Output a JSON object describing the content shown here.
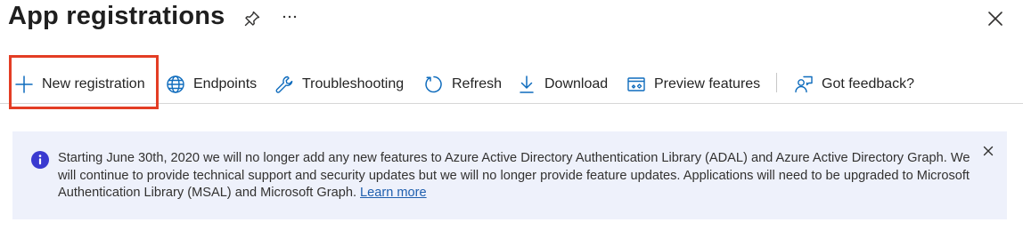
{
  "header": {
    "title": "App registrations"
  },
  "icons": {
    "pin": "pin-icon",
    "more": "more-icon",
    "close": "close-icon",
    "new_registration": "plus-icon",
    "endpoints": "globe-icon",
    "troubleshooting": "wrench-icon",
    "refresh": "refresh-icon",
    "download": "download-icon",
    "preview_features": "preview-icon",
    "feedback": "feedback-icon",
    "banner_info": "info-icon",
    "banner_close": "close-icon"
  },
  "toolbar": {
    "new_registration": "New registration",
    "endpoints": "Endpoints",
    "troubleshooting": "Troubleshooting",
    "refresh": "Refresh",
    "download": "Download",
    "preview_features": "Preview features",
    "got_feedback": "Got feedback?"
  },
  "banner": {
    "message": "Starting June 30th, 2020 we will no longer add any new features to Azure Active Directory Authentication Library (ADAL) and Azure Active Directory Graph. We will continue to provide technical support and security updates but we will no longer provide feature updates. Applications will need to be upgraded to Microsoft Authentication Library (MSAL) and Microsoft Graph.",
    "link_text": "Learn more"
  },
  "colors": {
    "accent": "#0f6cbd",
    "highlight": "#e33d24",
    "banner_background": "#eef1fb",
    "info_icon": "#3a3ad0",
    "link": "#1f5fae"
  }
}
